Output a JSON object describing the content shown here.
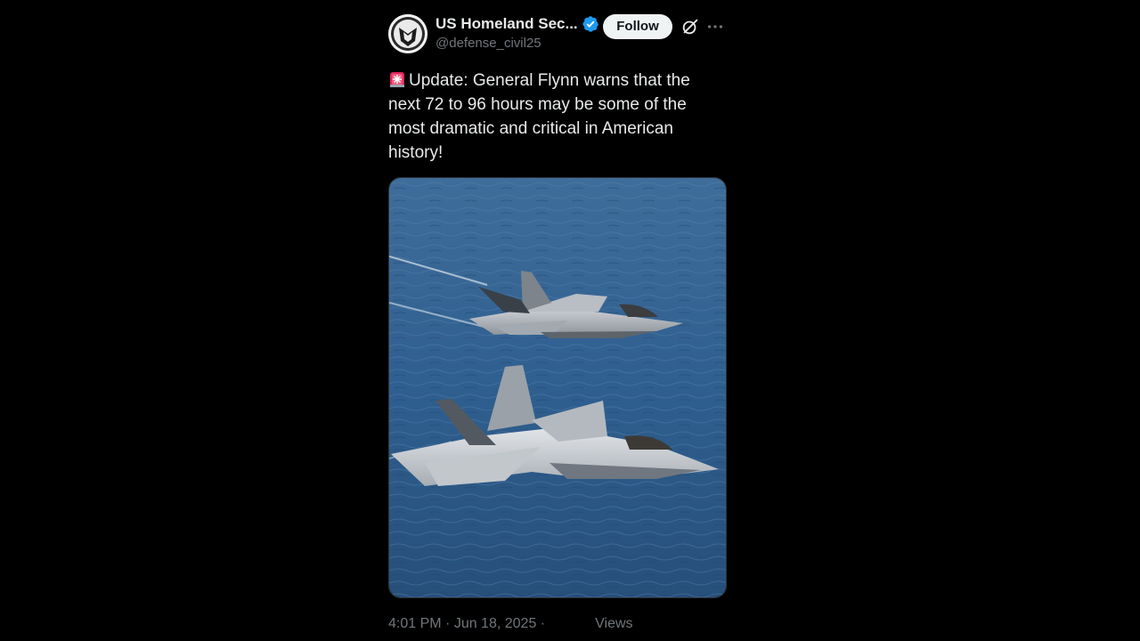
{
  "author": {
    "display_name": "US Homeland Sec...",
    "handle": "@defense_civil25",
    "verified": true,
    "avatar_icon": "shield-emblem-icon"
  },
  "actions": {
    "follow_label": "Follow",
    "grok_icon": "grok-icon",
    "more_icon": "more-icon"
  },
  "post": {
    "emoji": "siren-icon",
    "text": "Update: General Flynn warns that the next 72 to 96 hours may be some of the most dramatic and critical in American history!",
    "media_description_icon": "fighter-jets-photo"
  },
  "meta": {
    "time": "4:01 PM",
    "separator": " · ",
    "date": "Jun 18, 2025",
    "separator2": " ·",
    "views_label": "Views"
  },
  "colors": {
    "background": "#000000",
    "text": "#e7e9ea",
    "secondary": "#71767b",
    "verified": "#1d9bf0",
    "follow_bg": "#eff3f4"
  }
}
